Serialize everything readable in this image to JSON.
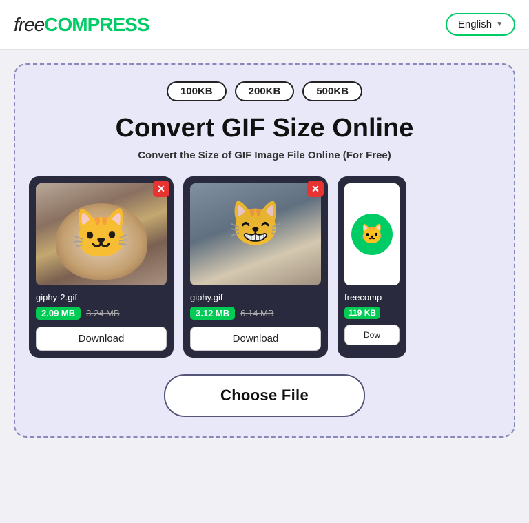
{
  "header": {
    "logo_free": "free",
    "logo_compress": "COMPRESS",
    "lang_label": "English",
    "lang_chevron": "▼"
  },
  "size_options": {
    "badge1": "100KB",
    "badge2": "200KB",
    "badge3": "500KB"
  },
  "hero": {
    "title": "Convert GIF Size Online",
    "subtitle": "Convert the Size of GIF Image File Online (For Free)"
  },
  "cards": [
    {
      "filename": "giphy-2.gif",
      "size_new": "2.09 MB",
      "size_old": "3.24 MB",
      "download_label": "Download"
    },
    {
      "filename": "giphy.gif",
      "size_new": "3.12 MB",
      "size_old": "6.14 MB",
      "download_label": "Download"
    },
    {
      "filename": "freecomp",
      "size_new": "119 KB",
      "download_label": "Dow"
    }
  ],
  "choose_file": {
    "label": "Choose File"
  }
}
